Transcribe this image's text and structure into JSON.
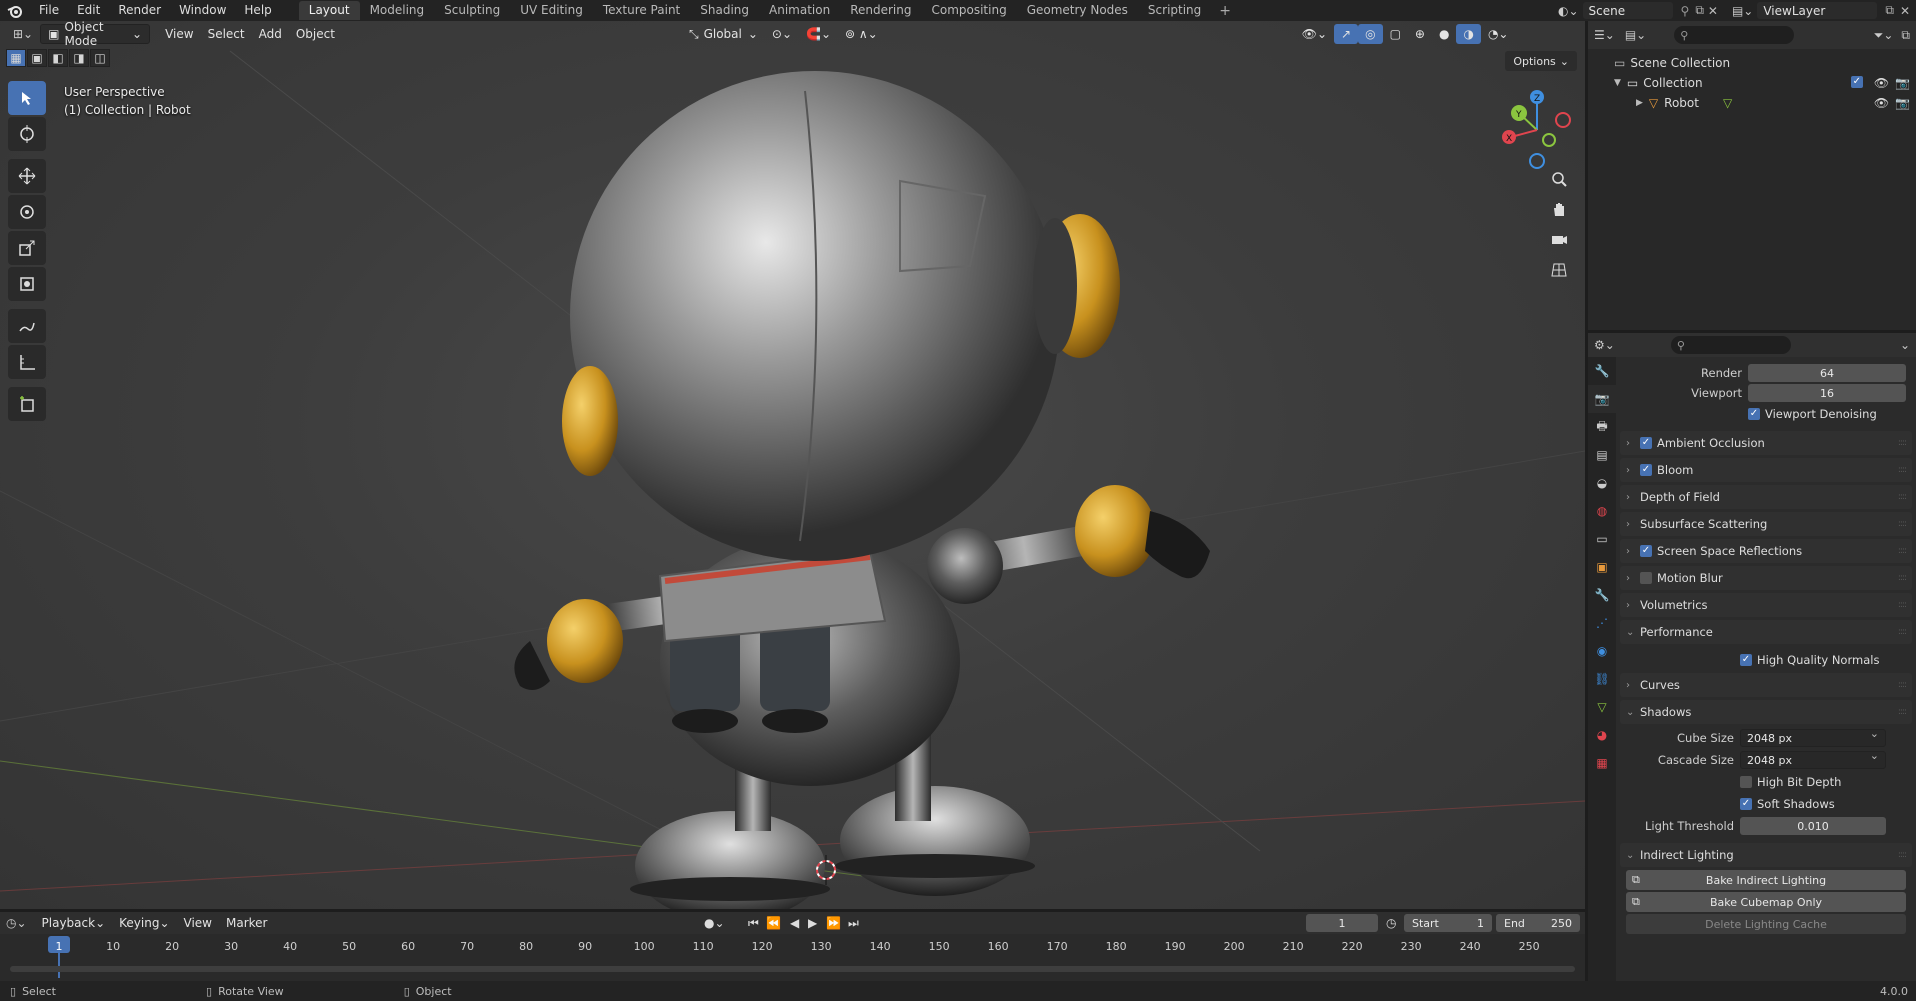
{
  "menubar": {
    "items": [
      "File",
      "Edit",
      "Render",
      "Window",
      "Help"
    ],
    "workspaces": [
      "Layout",
      "Modeling",
      "Sculpting",
      "UV Editing",
      "Texture Paint",
      "Shading",
      "Animation",
      "Rendering",
      "Compositing",
      "Geometry Nodes",
      "Scripting"
    ],
    "active_workspace": "Layout",
    "add_tab": "+",
    "scene": "Scene",
    "view_layer": "ViewLayer"
  },
  "viewport": {
    "mode": "Object Mode",
    "menus": [
      "View",
      "Select",
      "Add",
      "Object"
    ],
    "orientation": "Global",
    "options": "Options",
    "info_line1": "User Perspective",
    "info_line2": "(1) Collection | Robot",
    "gizmo_axes": [
      "X",
      "Y",
      "Z"
    ]
  },
  "outliner": {
    "scene_collection": "Scene Collection",
    "collection": "Collection",
    "object": "Robot"
  },
  "properties": {
    "render_label": "Render",
    "render_value": "64",
    "viewport_label": "Viewport",
    "viewport_value": "16",
    "viewport_denoising": "Viewport Denoising",
    "panels": {
      "ambient_occlusion": "Ambient Occlusion",
      "bloom": "Bloom",
      "depth_of_field": "Depth of Field",
      "subsurface_scattering": "Subsurface Scattering",
      "screen_space_reflections": "Screen Space Reflections",
      "motion_blur": "Motion Blur",
      "volumetrics": "Volumetrics",
      "performance": "Performance",
      "curves": "Curves",
      "shadows": "Shadows",
      "indirect_lighting": "Indirect Lighting"
    },
    "high_quality_normals": "High Quality Normals",
    "cube_size_label": "Cube Size",
    "cube_size_value": "2048 px",
    "cascade_size_label": "Cascade Size",
    "cascade_size_value": "2048 px",
    "high_bit_depth": "High Bit Depth",
    "soft_shadows": "Soft Shadows",
    "light_threshold_label": "Light Threshold",
    "light_threshold_value": "0.010",
    "bake_indirect": "Bake Indirect Lighting",
    "bake_cubemap": "Bake Cubemap Only",
    "delete_cache": "Delete Lighting Cache"
  },
  "timeline": {
    "playback": "Playback",
    "keying": "Keying",
    "view": "View",
    "marker": "Marker",
    "current_frame": "1",
    "start_label": "Start",
    "start_value": "1",
    "end_label": "End",
    "end_value": "250",
    "ruler": [
      "1",
      "10",
      "20",
      "30",
      "40",
      "50",
      "60",
      "70",
      "80",
      "90",
      "100",
      "110",
      "120",
      "130",
      "140",
      "150",
      "160",
      "170",
      "180",
      "190",
      "200",
      "210",
      "220",
      "230",
      "240",
      "250"
    ]
  },
  "statusbar": {
    "select": "Select",
    "rotate_view": "Rotate View",
    "object": "Object",
    "version": "4.0.0"
  },
  "colors": {
    "accent": "#4772b3",
    "x_axis": "#e0454e",
    "y_axis": "#8bc53f",
    "z_axis": "#3f8fe0",
    "gold": "#d9a62a"
  }
}
